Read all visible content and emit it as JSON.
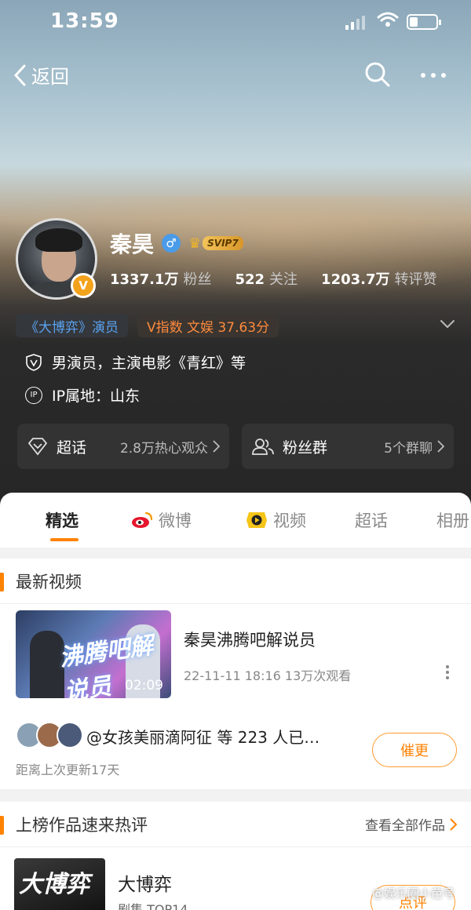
{
  "status_bar": {
    "time": "13:59"
  },
  "nav": {
    "back_label": "返回"
  },
  "profile": {
    "name": "秦昊",
    "gender_symbol": "♂",
    "vip_label": "SVIP7",
    "verify_badge": "V",
    "stats": [
      {
        "num": "1337.1万",
        "label": "粉丝"
      },
      {
        "num": "522",
        "label": "关注"
      },
      {
        "num": "1203.7万",
        "label": "转评赞"
      }
    ],
    "tags": [
      {
        "text": "《大博弈》演员"
      },
      {
        "text": "V指数 文娱 37.63分"
      }
    ],
    "verify_info": "男演员，主演电影《青红》等",
    "ip_info": "IP属地：山东"
  },
  "cards": [
    {
      "title": "超话",
      "sub": "2.8万热心观众"
    },
    {
      "title": "粉丝群",
      "sub": "5个群聊"
    }
  ],
  "tabs": [
    {
      "label": "精选"
    },
    {
      "label": "微博"
    },
    {
      "label": "视频"
    },
    {
      "label": "超话"
    },
    {
      "label": "相册"
    }
  ],
  "latest_videos": {
    "title": "最新视频",
    "video": {
      "title": "秦昊沸腾吧解说员",
      "meta": "22-11-11 18:16 13万次观看",
      "duration": "02:09",
      "thumb_text": "沸腾吧解说员"
    },
    "fans_text": "@女孩美丽滴阿征 等 223 人已…",
    "update_note": "距离上次更新17天",
    "urge_label": "催更"
  },
  "works": {
    "title": "上榜作品速来热评",
    "link_label": "查看全部作品",
    "item": {
      "poster_text": "大博弈",
      "title": "大博弈",
      "sub": "剧集 TOP14",
      "review_label": "点评"
    },
    "watermark": "@娱乐圈小芭号"
  },
  "colors": {
    "accent": "#ff8200",
    "tag_blue": "#5aa2ef",
    "tag_orange": "#ff8a3d"
  }
}
